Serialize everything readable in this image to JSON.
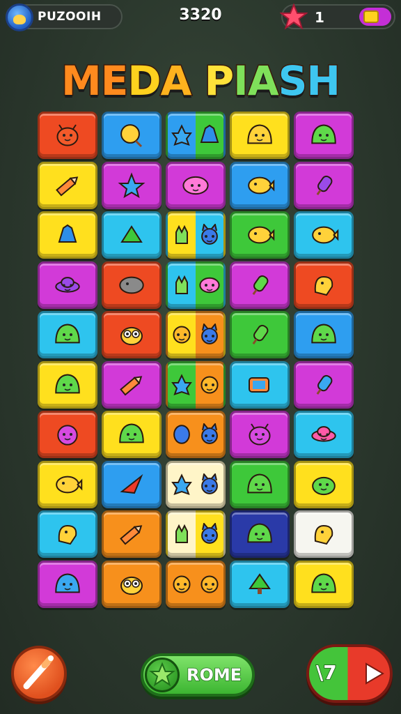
{
  "header": {
    "player_name": "PUZOOIH",
    "score": "3320",
    "lives": "1"
  },
  "title": {
    "parts": [
      {
        "text": "ME",
        "color": "#ff8a1e"
      },
      {
        "text": "D",
        "color": "#ffd11e"
      },
      {
        "text": "A",
        "color": "#ffb21e"
      },
      {
        "text": " P",
        "color": "#ffe23a"
      },
      {
        "text": "IA",
        "color": "#7fe05a"
      },
      {
        "text": "SH",
        "color": "#3ec6f0"
      }
    ]
  },
  "board": {
    "rows": 10,
    "cols": 5,
    "tiles": [
      [
        "red:bug",
        "blue:lollipop",
        "split:blue-green:star-blob",
        "yellow:slime",
        "magenta:slime-green"
      ],
      [
        "yellow:pencil",
        "magenta:star",
        "magenta:flower",
        "blue:fish",
        "magenta:popsicle"
      ],
      [
        "yellow:blob-blue",
        "cyan:leaf",
        "split:yellow-cyan:hand-cat",
        "green:fish",
        "cyan:fish"
      ],
      [
        "magenta:ufo",
        "red:seal",
        "split:cyan-green:hand-flower",
        "magenta:popsicle-green",
        "red:bird"
      ],
      [
        "cyan:slime-green",
        "red:owl",
        "split:yellow-orange:face-cat",
        "green:popsicle-green",
        "blue:slime-green"
      ],
      [
        "yellow:slime-green",
        "magenta:pencil-yellow",
        "split:green-orange:star-face",
        "cyan:battery",
        "magenta:popsicle-blue"
      ],
      [
        "red:monster",
        "yellow:slime-green",
        "split:orange-orange:egg-cat",
        "magenta:bug-magenta",
        "cyan:ufo-pink"
      ],
      [
        "yellow:fish",
        "blue:plane",
        "split:cream-cream:star-cat",
        "green:slime-green",
        "yellow:frog"
      ],
      [
        "cyan:bird-yellow",
        "orange:pencil",
        "split:cream-yellow:hand-cat",
        "navy:slime-green",
        "white:bird-yellow"
      ],
      [
        "magenta:slime-blue",
        "orange:owl",
        "split:orange-orange:face-face",
        "cyan:tree",
        "yellow:slime-green"
      ]
    ]
  },
  "controls": {
    "home_label": "ROME",
    "next_left": "\\7"
  },
  "colors": {
    "red": "#ee4a22",
    "blue": "#2e9ef0",
    "cyan": "#2ec4ee",
    "yellow": "#ffe01e",
    "magenta": "#d23ad8",
    "green": "#3ec83a",
    "orange": "#f7901c",
    "navy": "#2a3aa8",
    "cream": "#fff5c8",
    "white": "#f6f6f0"
  }
}
